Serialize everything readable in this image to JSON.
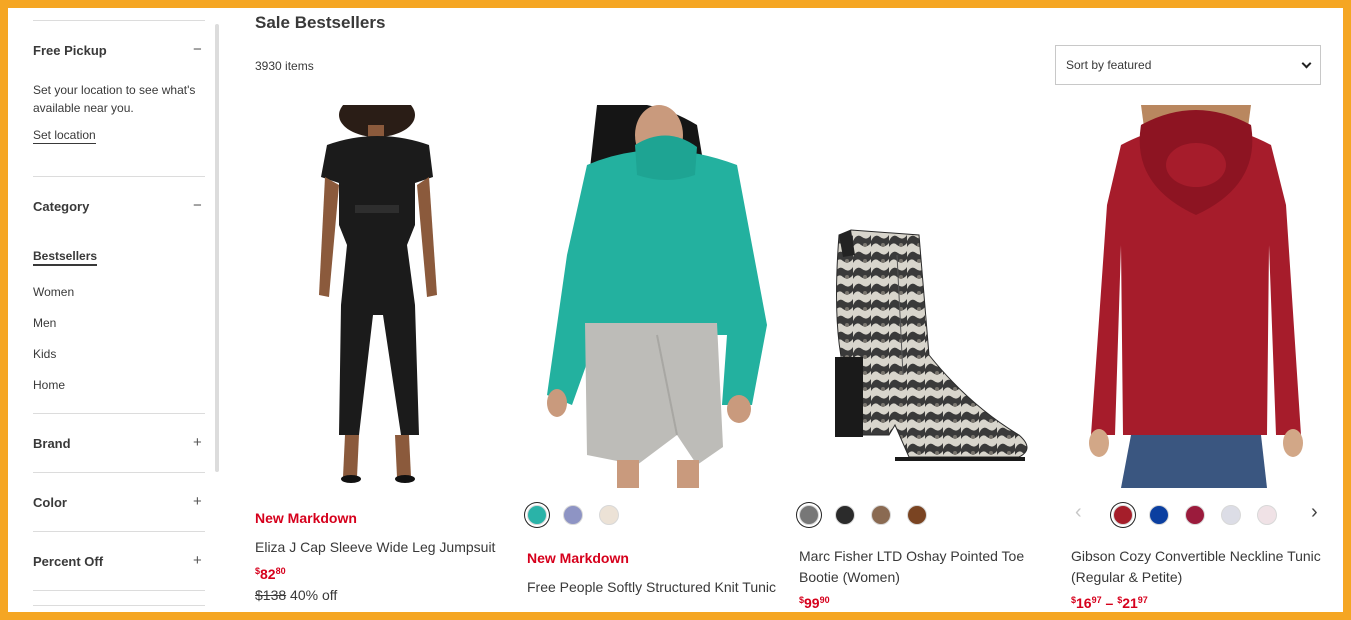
{
  "sidebar": {
    "pickup": {
      "title": "Free Pickup",
      "toggle": "−",
      "text": "Set your location to see what's available near you.",
      "link": "Set location"
    },
    "category": {
      "title": "Category",
      "toggle": "−",
      "items": [
        {
          "label": "Bestsellers"
        },
        {
          "label": "Women"
        },
        {
          "label": "Men"
        },
        {
          "label": "Kids"
        },
        {
          "label": "Home"
        }
      ]
    },
    "brand": {
      "title": "Brand",
      "toggle": "+"
    },
    "color": {
      "title": "Color",
      "toggle": "+"
    },
    "percent_off": {
      "title": "Percent Off",
      "toggle": "+"
    }
  },
  "header": {
    "title": "Sale Bestsellers",
    "count": "3930 items",
    "sort_label": "Sort by featured"
  },
  "products": [
    {
      "badge": "New Markdown",
      "name": "Eliza J Cap Sleeve Wide Leg Jumpsuit",
      "price_symbol": "$",
      "price_whole": "82",
      "price_cents": "80",
      "original_price": "$138",
      "discount": "40% off",
      "swatches": []
    },
    {
      "badge": "New Markdown",
      "name": "Free People Softly Structured Knit Tunic",
      "swatches": [
        "#2ab3a8",
        "#8e94c4",
        "#ece2d6"
      ]
    },
    {
      "name": "Marc Fisher LTD Oshay Pointed Toe Bootie (Women)",
      "price_symbol": "$",
      "price_whole": "99",
      "price_cents": "90",
      "swatches": [
        "#777777",
        "#2b2b2b",
        "#8a6a52",
        "#7a4422"
      ]
    },
    {
      "name": "Gibson Cozy Convertible Neckline Tunic (Regular & Petite)",
      "price_symbol": "$",
      "price_whole": "16",
      "price_cents": "97",
      "price_sep": " – ",
      "price2_symbol": "$",
      "price2_whole": "21",
      "price2_cents": "97",
      "swatches": [
        "#a51e2a",
        "#0b3fa0",
        "#9b1b3c",
        "#dcdde6",
        "#f0e2e6"
      ]
    }
  ],
  "carousel": {
    "prev": "‹",
    "next": "›"
  },
  "colors": {
    "accent_red": "#d6001c",
    "frame": "#f5a623"
  }
}
